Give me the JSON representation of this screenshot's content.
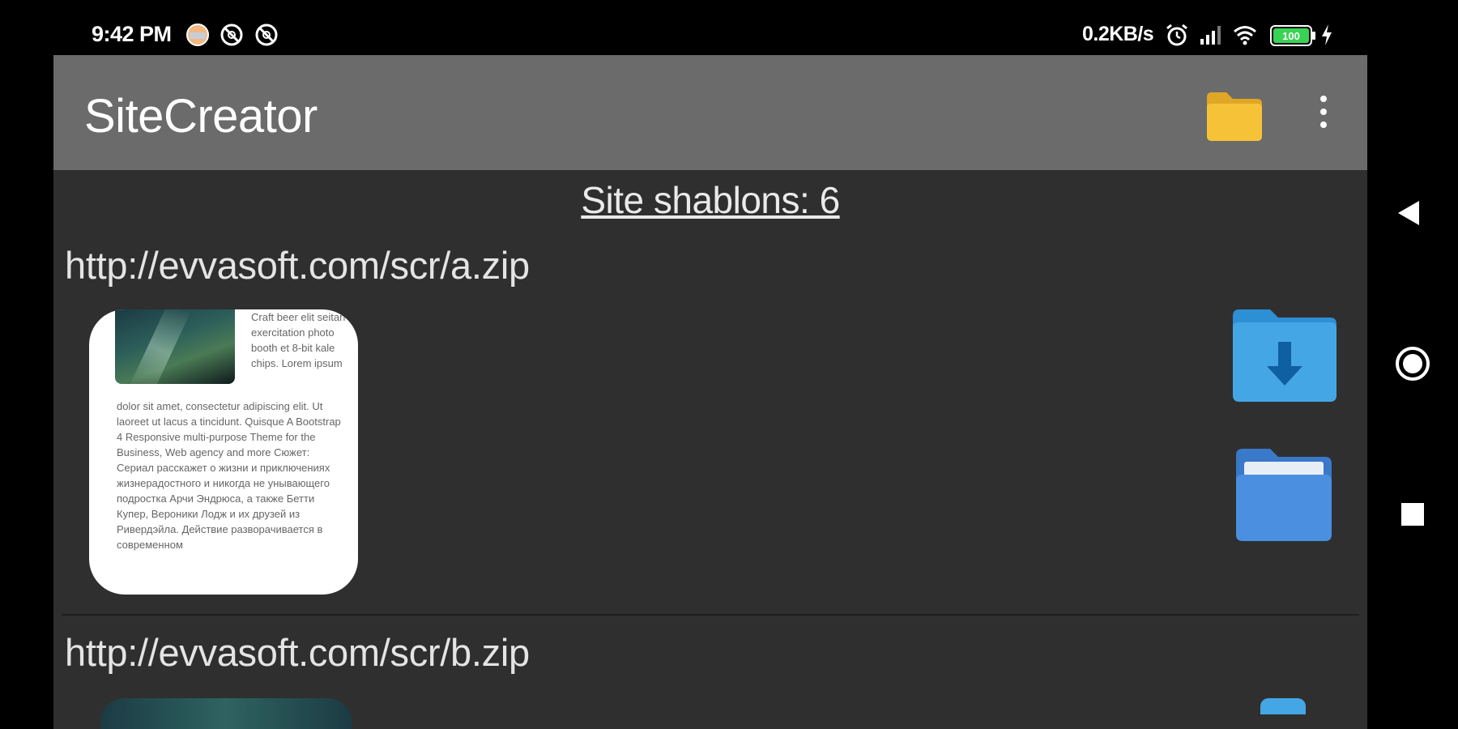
{
  "status_bar": {
    "time": "9:42 PM",
    "net_speed": "0.2KB/s",
    "battery_level": "100",
    "left_icons": [
      "avatar-icon",
      "blocked-icon",
      "blocked-icon"
    ],
    "right_icons": [
      "alarm-icon",
      "signal-icon",
      "wifi-icon",
      "battery-icon",
      "charging-icon"
    ]
  },
  "toolbar": {
    "title": "SiteCreator",
    "actions": [
      "folder-icon",
      "more-vert-icon"
    ]
  },
  "count_heading": "Site shablons: 6",
  "templates": [
    {
      "url": "http://evvasoft.com/scr/a.zip",
      "preview_text_side": "Craft beer elit seitan exercitation photo booth et 8-bit kale chips. Lorem ipsum",
      "preview_text_body": "dolor sit amet, consectetur adipiscing elit. Ut laoreet ut lacus a tincidunt. Quisque A Bootstrap 4 Responsive multi-purpose Theme for the Business, Web agency and more Сюжет: Сериал расскажет о жизни и приключениях жизнерадостного и никогда не унывающего подростка Арчи Эндрюса, а также Бетти Купер, Вероники Лодж и их друзей из Ривердэйла. Действие разворачивается в современном"
    },
    {
      "url": "http://evvasoft.com/scr/b.zip"
    }
  ],
  "colors": {
    "toolbar_bg": "#6b6b6b",
    "content_bg": "#2f2f2f",
    "folder_yellow": "#f6c338",
    "download_blue": "#45a6e6",
    "open_folder_blue": "#4a8fe0"
  }
}
